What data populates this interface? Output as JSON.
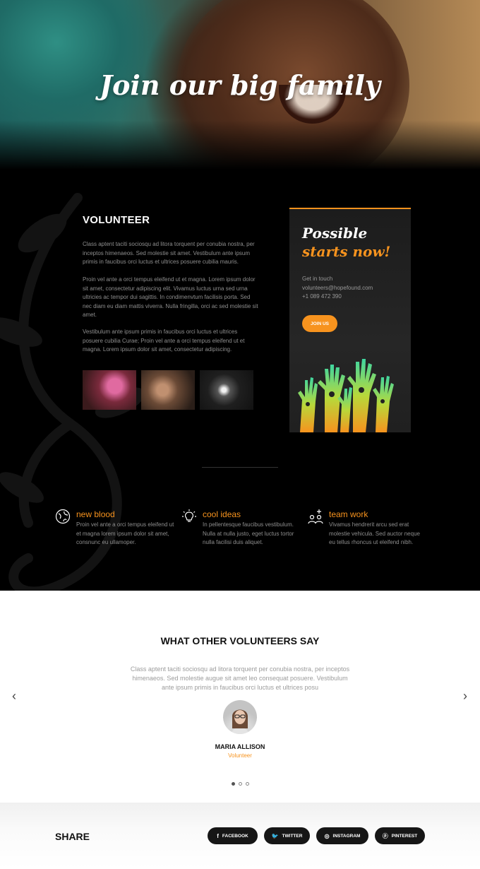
{
  "hero": {
    "title": "Join our big family"
  },
  "volunteer": {
    "title": "VOLUNTEER",
    "paragraphs": [
      "Class aptent taciti sociosqu ad litora torquent per conubia nostra, per inceptos himenaeos. Sed molestie sit amet. Vestibulum ante ipsum primis in faucibus orci luctus et ultrices posuere cubilia mauris.",
      "Proin vel ante a orci tempus eleifend ut et magna. Lorem ipsum dolor sit amet, consectetur adipiscing elit. Vivamus luctus urna sed urna ultricies ac tempor dui sagittis. In condimenvtum facilisis porta. Sed nec diam eu diam mattis viverra. Nulla fringilla, orci ac sed molestie sit amet.",
      "Vestibulum ante ipsum primis in faucibus orci luctus et ultrices posuere cubilia Curae; Proin vel ante a orci tempus eleifend ut et magna. Lorem ipsum dolor sit amet, consectetur adipiscing."
    ]
  },
  "card": {
    "line1": "Possible",
    "line2": "starts now!",
    "contact_label": "Get in touch",
    "email": "volunteers@hopefound.com",
    "phone": "+1 089 472 390",
    "join_label": "JOIN US"
  },
  "features": [
    {
      "icon": "globe-icon",
      "title": "new blood",
      "text": "Proin vel ante a orci tempus eleifend ut et magna lorem ipsum dolor sit amet, consnunc eu ullamoper."
    },
    {
      "icon": "lightbulb-icon",
      "title": "cool ideas",
      "text": "In pellentesque faucibus vestibulum. Nulla at nulla justo, eget luctus tortor nulla facilisi duis aliquet."
    },
    {
      "icon": "team-icon",
      "title": "team work",
      "text": "Vivamus hendrerit arcu sed erat molestie vehicula. Sed auctor neque eu tellus rhoncus ut eleifend nibh."
    }
  ],
  "testimonials": {
    "title": "WHAT OTHER VOLUNTEERS SAY",
    "quote": "Class aptent taciti sociosqu ad litora torquent per conubia nostra, per inceptos himenaeos. Sed molestie augue sit amet leo consequat posuere. Vestibulum ante ipsum primis in faucibus orci luctus et ultrices posu",
    "name": "MARIA ALLISON",
    "role": "Volunteer",
    "prev_glyph": "‹",
    "next_glyph": "›",
    "slide_count": 3,
    "active_slide": 1
  },
  "share": {
    "label": "SHARE",
    "buttons": [
      {
        "icon": "facebook-icon",
        "glyph": "f",
        "label": "FACEBOOK"
      },
      {
        "icon": "twitter-icon",
        "glyph": "🐦",
        "label": "TWITTER"
      },
      {
        "icon": "instagram-icon",
        "glyph": "◎",
        "label": "INSTAGRAM"
      },
      {
        "icon": "pinterest-icon",
        "glyph": "ⓟ",
        "label": "PINTEREST"
      }
    ]
  },
  "colors": {
    "accent": "#f7931e",
    "dark": "#000000",
    "button_dark": "#161616"
  }
}
